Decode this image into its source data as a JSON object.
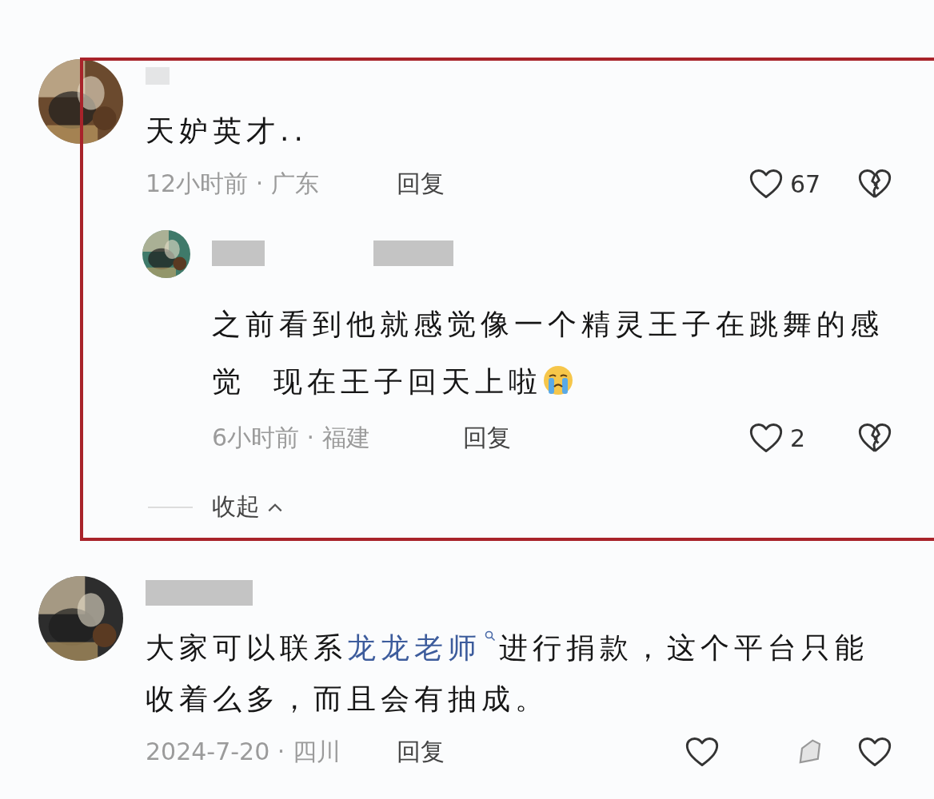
{
  "comments": [
    {
      "avatar": {
        "kind": "picture"
      },
      "highlighted": true,
      "segments": [
        {
          "kind": "text",
          "text": "天妒英才.."
        }
      ],
      "time": "12小时前 · 广东",
      "reply": "回复",
      "actions": [
        {
          "kind": "like",
          "count": "67"
        },
        {
          "kind": "dislike"
        }
      ],
      "replies": [
        {
          "avatar": {
            "kind": "picture"
          },
          "highlighted": false,
          "segments": [
            {
              "kind": "text",
              "text": "之前看到他就感觉像一个精灵王子在跳舞的感觉  现在王子回天上啦"
            },
            {
              "kind": "emoji"
            }
          ],
          "time": "6小时前 · 福建",
          "reply": "回复",
          "actions": [
            {
              "kind": "like",
              "count": "2"
            },
            {
              "kind": "dislike"
            }
          ]
        }
      ],
      "collapse": "收起"
    },
    {
      "avatar": {
        "kind": "picture"
      },
      "highlighted": false,
      "segments": [
        {
          "kind": "text",
          "text": "大家可以联系"
        },
        {
          "kind": "link",
          "text": "龙龙老师"
        },
        {
          "kind": "text",
          "text": "进行捐款，这个平台只能收着么多，而且会有抽成。"
        }
      ],
      "time": "2024-7-20 · 四川",
      "reply": "回复",
      "actions": [
        {
          "kind": "like"
        },
        {
          "kind": "share"
        },
        {
          "kind": "like"
        }
      ]
    }
  ]
}
